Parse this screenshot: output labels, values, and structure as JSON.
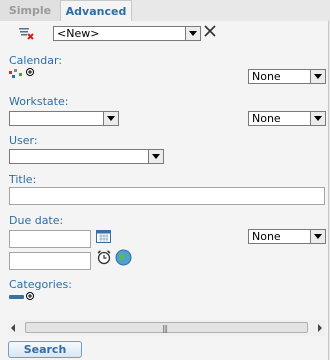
{
  "tabs": {
    "simple": "Simple",
    "advanced": "Advanced"
  },
  "saved_search": {
    "selected": "<New>"
  },
  "calendar": {
    "label": "Calendar:",
    "option": "None"
  },
  "workstate": {
    "label": "Workstate:",
    "value": "",
    "option": "None"
  },
  "user": {
    "label": "User:",
    "value": ""
  },
  "title": {
    "label": "Title:",
    "value": ""
  },
  "due_date": {
    "label": "Due date:",
    "from": "",
    "to": "",
    "option": "None"
  },
  "categories": {
    "label": "Categories:"
  },
  "search_button": "Search",
  "colors": {
    "accent": "#2d6ea6",
    "panel": "#f4f4f4"
  }
}
